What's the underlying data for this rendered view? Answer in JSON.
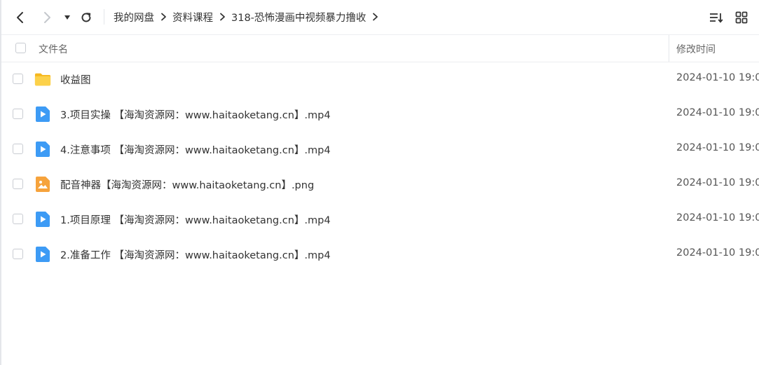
{
  "toolbar": {
    "breadcrumb": [
      "我的网盘",
      "资料课程",
      "318-恐怖漫画中视频暴力撸收"
    ]
  },
  "header": {
    "name_label": "文件名",
    "time_label": "修改时间"
  },
  "files": [
    {
      "name": "收益图",
      "type": "folder",
      "modified": "2024-01-10 19:0"
    },
    {
      "name": "3.项目实操 【海淘资源网：www.haitaoketang.cn】.mp4",
      "type": "video",
      "modified": "2024-01-10 19:0"
    },
    {
      "name": "4.注意事项 【海淘资源网：www.haitaoketang.cn】.mp4",
      "type": "video",
      "modified": "2024-01-10 19:0"
    },
    {
      "name": "配音神器【海淘资源网：www.haitaoketang.cn】.png",
      "type": "image",
      "modified": "2024-01-10 19:0"
    },
    {
      "name": "1.项目原理 【海淘资源网：www.haitaoketang.cn】.mp4",
      "type": "video",
      "modified": "2024-01-10 19:0"
    },
    {
      "name": "2.准备工作 【海淘资源网：www.haitaoketang.cn】.mp4",
      "type": "video",
      "modified": "2024-01-10 19:0"
    }
  ],
  "icons": {
    "folder_icon": "folder-icon",
    "video_icon": "video-file-icon",
    "image_icon": "image-file-icon"
  },
  "colors": {
    "folder": "#f9c531",
    "video": "#3d9bf5",
    "image": "#f6a33c"
  }
}
